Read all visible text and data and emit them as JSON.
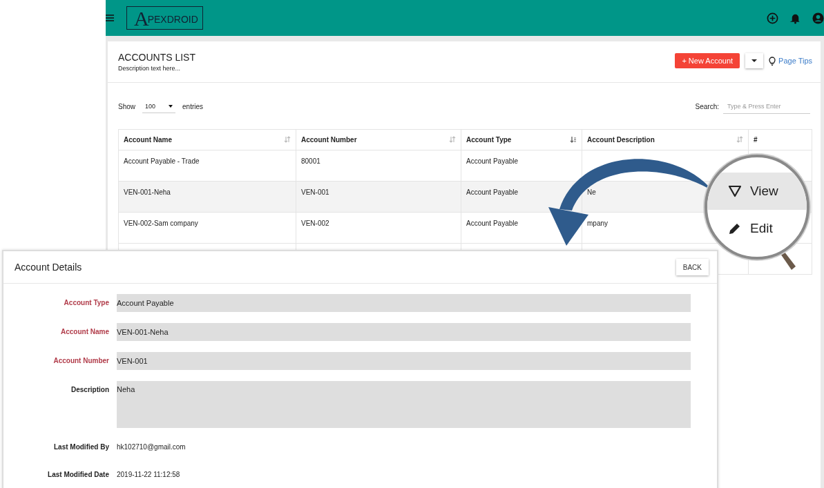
{
  "topbar": {
    "logo": {
      "initial": "A",
      "rest": "PEXDROID"
    }
  },
  "page": {
    "title": "ACCOUNTS LIST",
    "description": "Description text here...",
    "new_button": "+ New Account",
    "tips": "Page Tips"
  },
  "controls": {
    "show_label": "Show",
    "page_size": "100",
    "entries_label": "entries",
    "search_label": "Search:",
    "search_placeholder": "Type & Press Enter"
  },
  "table": {
    "columns": [
      {
        "label": "Account Name",
        "sorted": false
      },
      {
        "label": "Account Number",
        "sorted": false
      },
      {
        "label": "Account Type",
        "sorted": true
      },
      {
        "label": "Account Description",
        "sorted": false
      },
      {
        "label": "#"
      }
    ],
    "rows": [
      {
        "cells": [
          "Account Payable - Trade",
          "80001",
          "Account Payable",
          ""
        ],
        "selected": false
      },
      {
        "cells": [
          "VEN-001-Neha",
          "VEN-001",
          "Account Payable",
          "Ne"
        ],
        "selected": true
      },
      {
        "cells": [
          "VEN-002-Sam company",
          "VEN-002",
          "Account Payable",
          "mpany"
        ],
        "selected": false
      },
      {
        "cells": [
          "",
          "",
          "",
          ""
        ],
        "selected": false
      }
    ]
  },
  "magnifier": {
    "items": [
      {
        "kind": "view",
        "label": "View",
        "selected": true
      },
      {
        "kind": "edit",
        "label": "Edit",
        "selected": false
      }
    ]
  },
  "details": {
    "title": "Account Details",
    "back": "BACK",
    "fields": [
      {
        "kind": "input",
        "label": "Account Type",
        "value": "Account Payable",
        "required": true
      },
      {
        "kind": "input",
        "label": "Account Name",
        "value": "VEN-001-Neha",
        "required": true
      },
      {
        "kind": "input",
        "label": "Account Number",
        "value": "VEN-001",
        "required": true
      },
      {
        "kind": "textarea",
        "label": "Description",
        "value": "Neha",
        "required": false
      },
      {
        "kind": "text",
        "label": "Last Modified By",
        "value": "hk102710@gmail.com",
        "required": false
      },
      {
        "kind": "text",
        "label": "Last Modified Date",
        "value": "2019-11-22 11:12:58",
        "required": false
      }
    ]
  }
}
